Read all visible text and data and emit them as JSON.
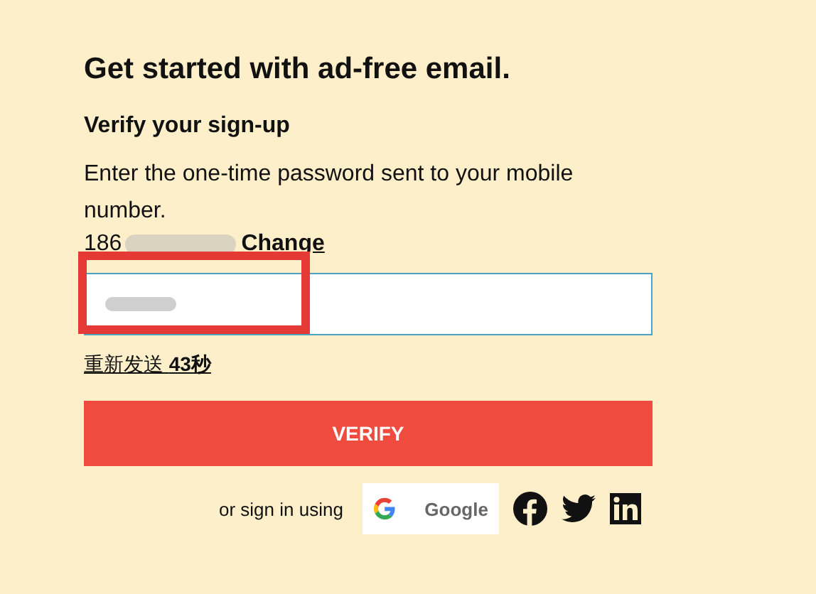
{
  "title": "Get started with ad-free email.",
  "subtitle": "Verify your sign-up",
  "instructions": "Enter the one-time password sent to your mobile number.",
  "phone": {
    "visible": "186",
    "change_link": "Change"
  },
  "otp_field": {
    "redacted": true
  },
  "resend": {
    "label": "重新发送",
    "countdown": "43秒"
  },
  "verify_button": "VERIFY",
  "social": {
    "prompt": "or sign in using",
    "providers": [
      {
        "kind": "google",
        "label": "Google"
      },
      {
        "kind": "facebook"
      },
      {
        "kind": "twitter"
      },
      {
        "kind": "linkedin"
      }
    ]
  }
}
